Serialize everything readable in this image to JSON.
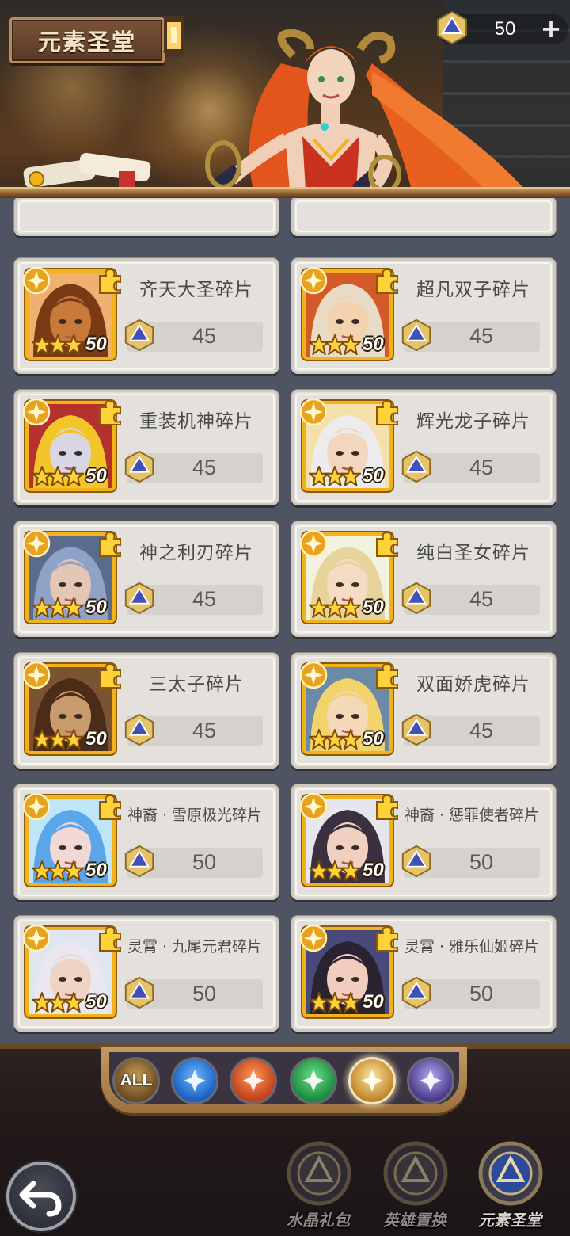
{
  "header": {
    "title": "元素圣堂",
    "currency_value": "50",
    "currency_add_label": "+"
  },
  "items": [
    {
      "name": "齐天大圣碎片",
      "price": "45",
      "level": "50",
      "portrait": "monkey-king",
      "skin": "#c77a3a",
      "hair": "#7a3a14",
      "bg": "#f0b070"
    },
    {
      "name": "超凡双子碎片",
      "price": "45",
      "level": "50",
      "portrait": "twins",
      "skin": "#f3d2b0",
      "hair": "#e9dcc6",
      "bg": "#d45a2a"
    },
    {
      "name": "重装机神碎片",
      "price": "45",
      "level": "50",
      "portrait": "mech-rabbit",
      "skin": "#d8d6e4",
      "hair": "#f3c52a",
      "bg": "#b5312e"
    },
    {
      "name": "辉光龙子碎片",
      "price": "45",
      "level": "50",
      "portrait": "dragon-son",
      "skin": "#f2d7be",
      "hair": "#ececec",
      "bg": "#f4e0a8"
    },
    {
      "name": "神之利刃碎片",
      "price": "45",
      "level": "50",
      "portrait": "divine-blade",
      "skin": "#e3c6b6",
      "hair": "#8fa2c8",
      "bg": "#5a6b8c"
    },
    {
      "name": "纯白圣女碎片",
      "price": "45",
      "level": "50",
      "portrait": "white-saint",
      "skin": "#f4dcc4",
      "hair": "#e6d49a",
      "bg": "#f3f1e0"
    },
    {
      "name": "三太子碎片",
      "price": "45",
      "level": "50",
      "portrait": "third-prince",
      "skin": "#c89a6c",
      "hair": "#4a2c18",
      "bg": "#7a5432"
    },
    {
      "name": "双面娇虎碎片",
      "price": "45",
      "level": "50",
      "portrait": "tiger-girl",
      "skin": "#f5d8b8",
      "hair": "#f2d36c",
      "bg": "#6a8aa8"
    },
    {
      "name": "神裔 · 雪原极光碎片",
      "price": "50",
      "level": "50",
      "portrait": "aurora",
      "skin": "#f1d8d4",
      "hair": "#5aa6e8",
      "bg": "#bfe6f8"
    },
    {
      "name": "神裔 · 惩罪使者碎片",
      "price": "50",
      "level": "50",
      "portrait": "punisher",
      "skin": "#f0d0c0",
      "hair": "#3a3040",
      "bg": "#e6e6ee"
    },
    {
      "name": "灵霄 · 九尾元君碎片",
      "price": "50",
      "level": "50",
      "portrait": "nine-tails",
      "skin": "#efd4c6",
      "hair": "#e8e8ee",
      "bg": "#dfe6f0"
    },
    {
      "name": "灵霄 · 雅乐仙姬碎片",
      "price": "50",
      "level": "50",
      "portrait": "fairy",
      "skin": "#f2cdbe",
      "hair": "#2a2432",
      "bg": "#4a4a7a"
    }
  ],
  "filters": [
    {
      "id": "all",
      "label": "ALL",
      "color": "#6a4a20",
      "ring": "#c8a25a"
    },
    {
      "id": "water",
      "label": "",
      "color": "#1a5fc2",
      "ring": "#6ab8ff"
    },
    {
      "id": "fire",
      "label": "",
      "color": "#c0401a",
      "ring": "#ff9a5a"
    },
    {
      "id": "wind",
      "label": "",
      "color": "#1d8a3e",
      "ring": "#6ae08a"
    },
    {
      "id": "light",
      "label": "",
      "color": "#c0862a",
      "ring": "#ffe6a0",
      "active": true
    },
    {
      "id": "dark",
      "label": "",
      "color": "#4a3a8a",
      "ring": "#b6a8f0"
    }
  ],
  "nav": [
    {
      "id": "crystal-gift",
      "label": "水晶礼包",
      "icon": "crystal-gift-icon"
    },
    {
      "id": "hero-swap",
      "label": "英雄置换",
      "icon": "hero-swap-icon"
    },
    {
      "id": "element-hall",
      "label": "元素圣堂",
      "icon": "element-hall-icon",
      "active": true
    }
  ],
  "colors": {
    "card_bg": "#e4e1dc",
    "price_box": "#d5d1cc",
    "frame_gold": "#f2b21a",
    "page_bg": "#4f5462"
  }
}
